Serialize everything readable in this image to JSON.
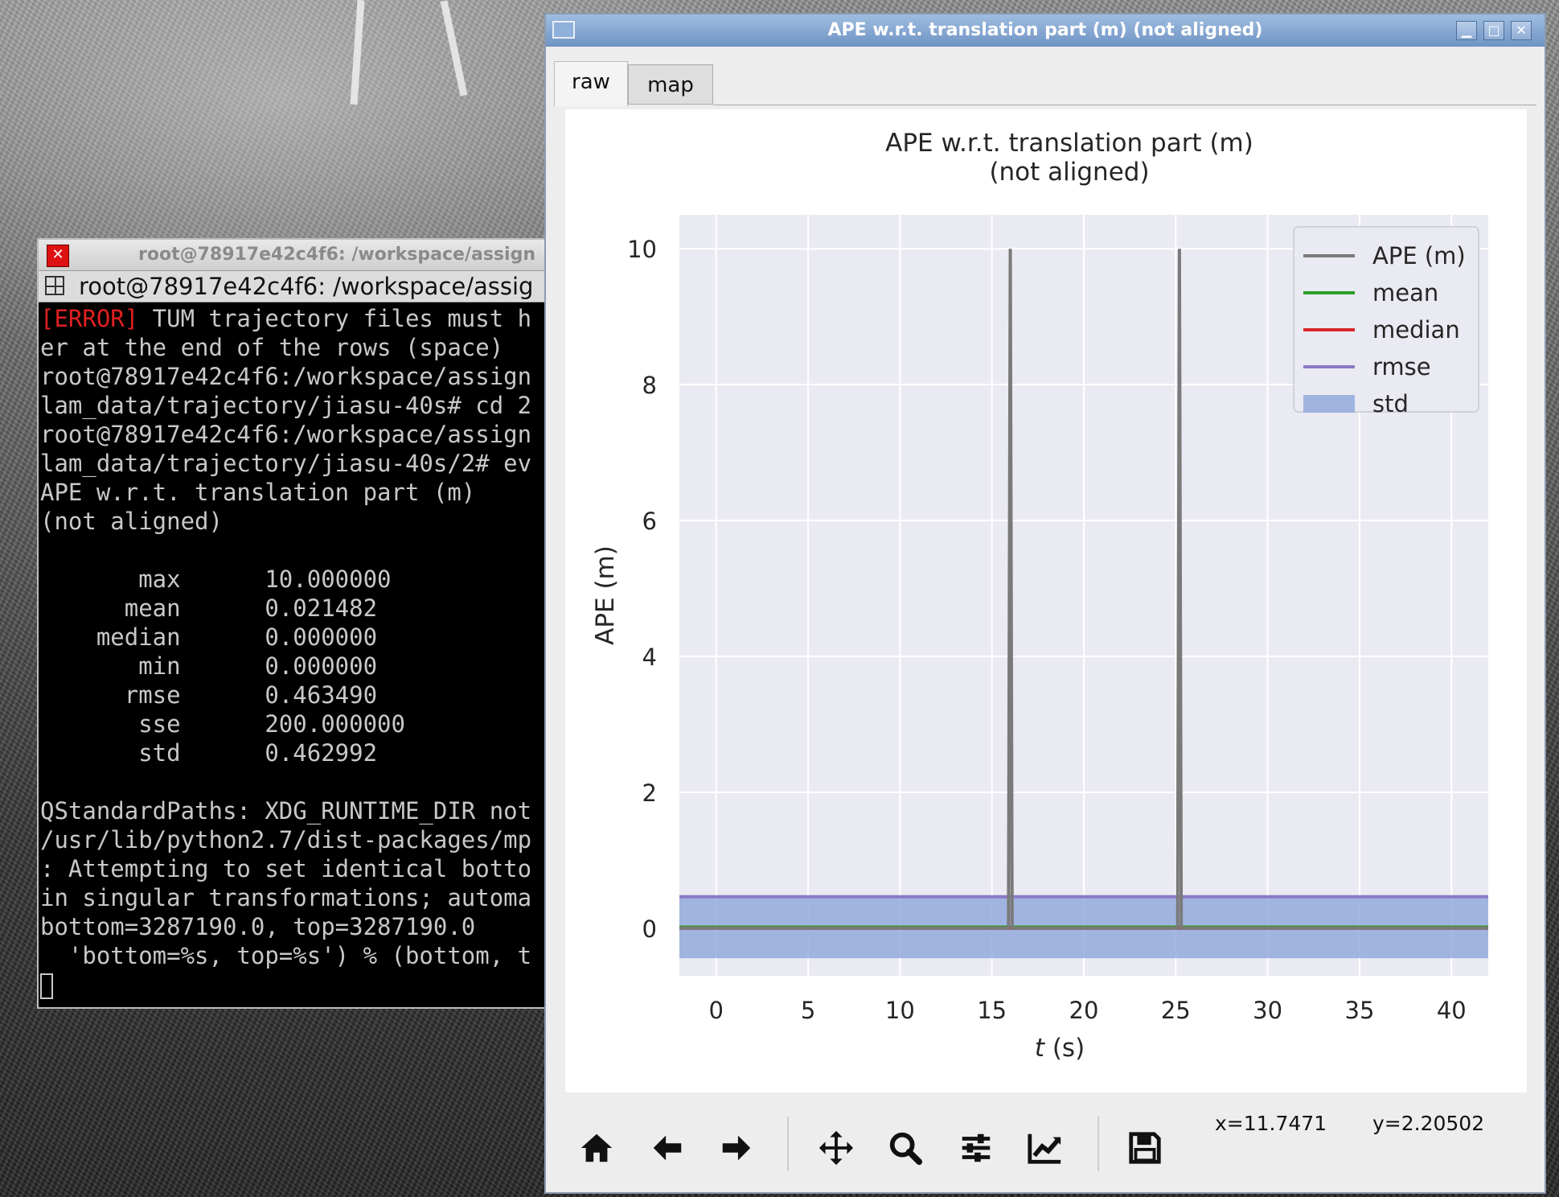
{
  "terminal": {
    "title": "root@78917e42c4f6: /workspace/assign",
    "tab_label": "root@78917e42c4f6: /workspace/assig",
    "lines": [
      {
        "prefix": "[ERROR]",
        "text": " TUM trajectory files must h"
      },
      {
        "prefix": "",
        "text": "er at the end of the rows (space)"
      },
      {
        "prefix": "",
        "text": "root@78917e42c4f6:/workspace/assign"
      },
      {
        "prefix": "",
        "text": "lam_data/trajectory/jiasu-40s# cd 2"
      },
      {
        "prefix": "",
        "text": "root@78917e42c4f6:/workspace/assign"
      },
      {
        "prefix": "",
        "text": "lam_data/trajectory/jiasu-40s/2# ev"
      },
      {
        "prefix": "",
        "text": "APE w.r.t. translation part (m)"
      },
      {
        "prefix": "",
        "text": "(not aligned)"
      },
      {
        "prefix": "",
        "text": ""
      },
      {
        "prefix": "",
        "text": "       max      10.000000"
      },
      {
        "prefix": "",
        "text": "      mean      0.021482"
      },
      {
        "prefix": "",
        "text": "    median      0.000000"
      },
      {
        "prefix": "",
        "text": "       min      0.000000"
      },
      {
        "prefix": "",
        "text": "      rmse      0.463490"
      },
      {
        "prefix": "",
        "text": "       sse      200.000000"
      },
      {
        "prefix": "",
        "text": "       std      0.462992"
      },
      {
        "prefix": "",
        "text": ""
      },
      {
        "prefix": "",
        "text": "QStandardPaths: XDG_RUNTIME_DIR not"
      },
      {
        "prefix": "",
        "text": "/usr/lib/python2.7/dist-packages/mp"
      },
      {
        "prefix": "",
        "text": ": Attempting to set identical botto"
      },
      {
        "prefix": "",
        "text": "in singular transformations; automa"
      },
      {
        "prefix": "",
        "text": "bottom=3287190.0, top=3287190.0"
      },
      {
        "prefix": "",
        "text": "  'bottom=%s, top=%s') % (bottom, t"
      }
    ]
  },
  "plot_window": {
    "title": "APE w.r.t. translation part (m) (not aligned)",
    "tabs": [
      {
        "label": "raw"
      },
      {
        "label": "map"
      }
    ],
    "coords": {
      "x": "x=11.7471",
      "y": "y=2.20502"
    },
    "toolbar_icons": [
      "home-icon",
      "back-arrow-icon",
      "forward-arrow-icon",
      "pan-icon",
      "zoom-icon",
      "configure-subplots-icon",
      "edit-axis-icon",
      "save-icon"
    ]
  },
  "chart_data": {
    "type": "line",
    "title_line1": "APE w.r.t. translation part (m)",
    "title_line2": "(not aligned)",
    "xlabel": "t (s)",
    "ylabel": "APE (m)",
    "xlim": [
      -2,
      42
    ],
    "ylim": [
      -0.7,
      10.5
    ],
    "xticks": [
      0,
      5,
      10,
      15,
      20,
      25,
      30,
      35,
      40
    ],
    "yticks": [
      0,
      2,
      4,
      6,
      8,
      10
    ],
    "grid": true,
    "legend_position": "top-right",
    "series": [
      {
        "name": "APE (m)",
        "color": "#7a7a7a",
        "x": [
          -2,
          15.9,
          16.0,
          16.1,
          25.1,
          25.2,
          25.3,
          42
        ],
        "y": [
          0,
          0,
          10,
          0,
          0,
          10,
          0,
          0
        ]
      },
      {
        "name": "mean",
        "color": "#2ca02c",
        "value": 0.021482
      },
      {
        "name": "median",
        "color": "#d62728",
        "value": 0.0
      },
      {
        "name": "rmse",
        "color": "#8c7bc6",
        "value": 0.46349
      },
      {
        "name": "std",
        "color": "#8ea6db",
        "band_center": 0.021482,
        "band_half_width": 0.462992
      }
    ],
    "background": "#eaeaf2"
  }
}
